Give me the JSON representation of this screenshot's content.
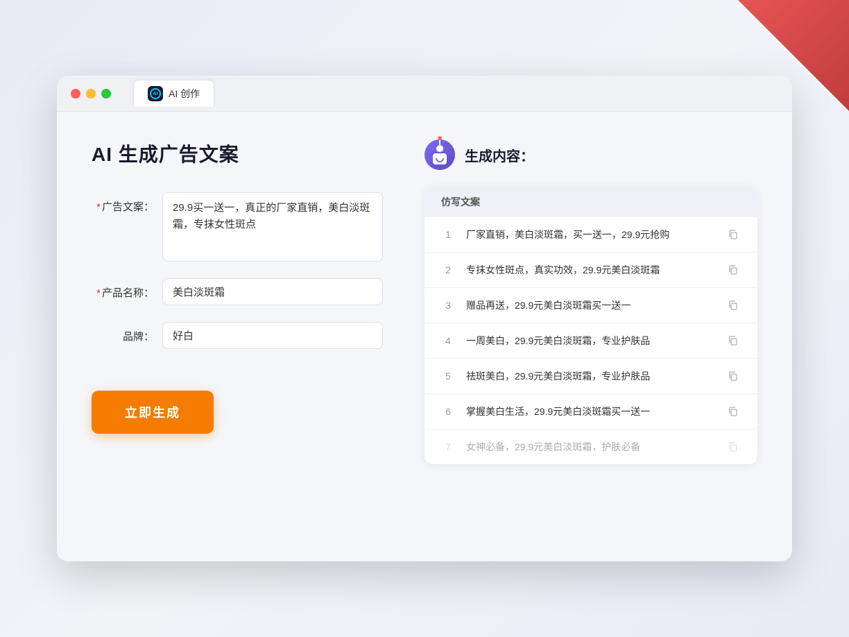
{
  "window": {
    "tab_label": "AI 创作"
  },
  "page": {
    "title": "AI 生成广告文案"
  },
  "form": {
    "ad_copy_label": "广告文案：",
    "ad_copy_required": "*",
    "ad_copy_value": "29.9买一送一，真正的厂家直销，美白淡斑霜，专抹女性斑点",
    "product_name_label": "产品名称：",
    "product_name_required": "*",
    "product_name_value": "美白淡斑霜",
    "brand_label": "品牌：",
    "brand_value": "好白",
    "submit_label": "立即生成"
  },
  "results": {
    "header_label": "生成内容：",
    "table_header": "仿写文案",
    "items": [
      {
        "number": "1",
        "text": "厂家直销，美白淡斑霜，买一送一，29.9元抢购"
      },
      {
        "number": "2",
        "text": "专抹女性斑点，真实功效，29.9元美白淡斑霜"
      },
      {
        "number": "3",
        "text": "赠品再送，29.9元美白淡斑霜买一送一"
      },
      {
        "number": "4",
        "text": "一周美白，29.9元美白淡斑霜，专业护肤品"
      },
      {
        "number": "5",
        "text": "祛斑美白，29.9元美白淡斑霜，专业护肤品"
      },
      {
        "number": "6",
        "text": "掌握美白生活，29.9元美白淡斑霜买一送一"
      },
      {
        "number": "7",
        "text": "女神必备，29.9元美白淡斑霜，护肤必备",
        "faded": true
      }
    ]
  }
}
